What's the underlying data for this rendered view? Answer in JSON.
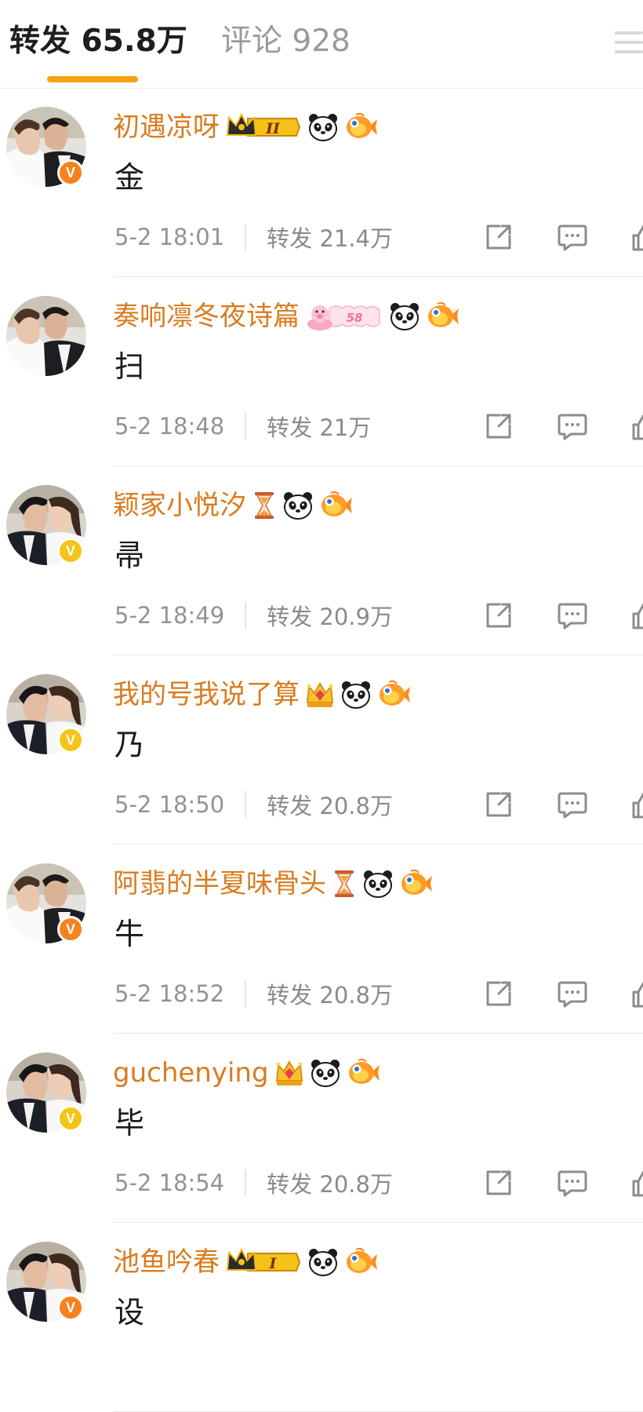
{
  "tabs": {
    "repost_label": "转发 65.8万",
    "comment_label": "评论 928"
  },
  "colors": {
    "accent": "#f7a20e",
    "username": "#d87c1f",
    "verified_orange": "#f5821f",
    "verified_yellow": "#f6c415"
  },
  "reposts": [
    {
      "username": "初遇凉呀",
      "badges": [
        "crown-level-2-badge",
        "panda-icon",
        "goldfish-icon"
      ],
      "badge_level": "II",
      "verified": "orange",
      "avatar": "wedding-kiss-photo-a",
      "text": "金",
      "time": "5-2 18:01",
      "repost_count": "转发 21.4万"
    },
    {
      "username": "奏响凛冬夜诗篇",
      "badges": [
        "pink-pig-level-badge",
        "panda-icon",
        "goldfish-icon"
      ],
      "badge_level": "58",
      "verified": "none",
      "avatar": "wedding-kiss-photo-a",
      "text": "扫",
      "time": "5-2 18:48",
      "repost_count": "转发 21万"
    },
    {
      "username": "颖家小悦汐",
      "badges": [
        "hourglass-icon",
        "panda-icon",
        "goldfish-icon"
      ],
      "verified": "yellow",
      "avatar": "wedding-kiss-photo-b",
      "text": "帚",
      "time": "5-2 18:49",
      "repost_count": "转发 20.9万"
    },
    {
      "username": "我的号我说了算",
      "badges": [
        "gem-crown-icon",
        "panda-icon",
        "goldfish-icon"
      ],
      "verified": "yellow",
      "avatar": "wedding-kiss-photo-b",
      "text": "乃",
      "time": "5-2 18:50",
      "repost_count": "转发 20.8万"
    },
    {
      "username": "阿翡的半夏味骨头",
      "badges": [
        "hourglass-icon",
        "panda-icon",
        "goldfish-icon"
      ],
      "verified": "orange",
      "avatar": "wedding-kiss-photo-a",
      "text": "牛",
      "time": "5-2 18:52",
      "repost_count": "转发 20.8万"
    },
    {
      "username": "guchenying",
      "badges": [
        "gem-crown-icon",
        "panda-icon",
        "goldfish-icon"
      ],
      "verified": "yellow",
      "avatar": "wedding-kiss-photo-b",
      "text": "毕",
      "time": "5-2 18:54",
      "repost_count": "转发 20.8万"
    },
    {
      "username": "池鱼吟春",
      "badges": [
        "crown-level-1-badge",
        "panda-icon",
        "goldfish-icon"
      ],
      "badge_level": "I",
      "verified": "orange",
      "avatar": "wedding-kiss-photo-b",
      "text": "设",
      "time": "",
      "repost_count": ""
    }
  ]
}
